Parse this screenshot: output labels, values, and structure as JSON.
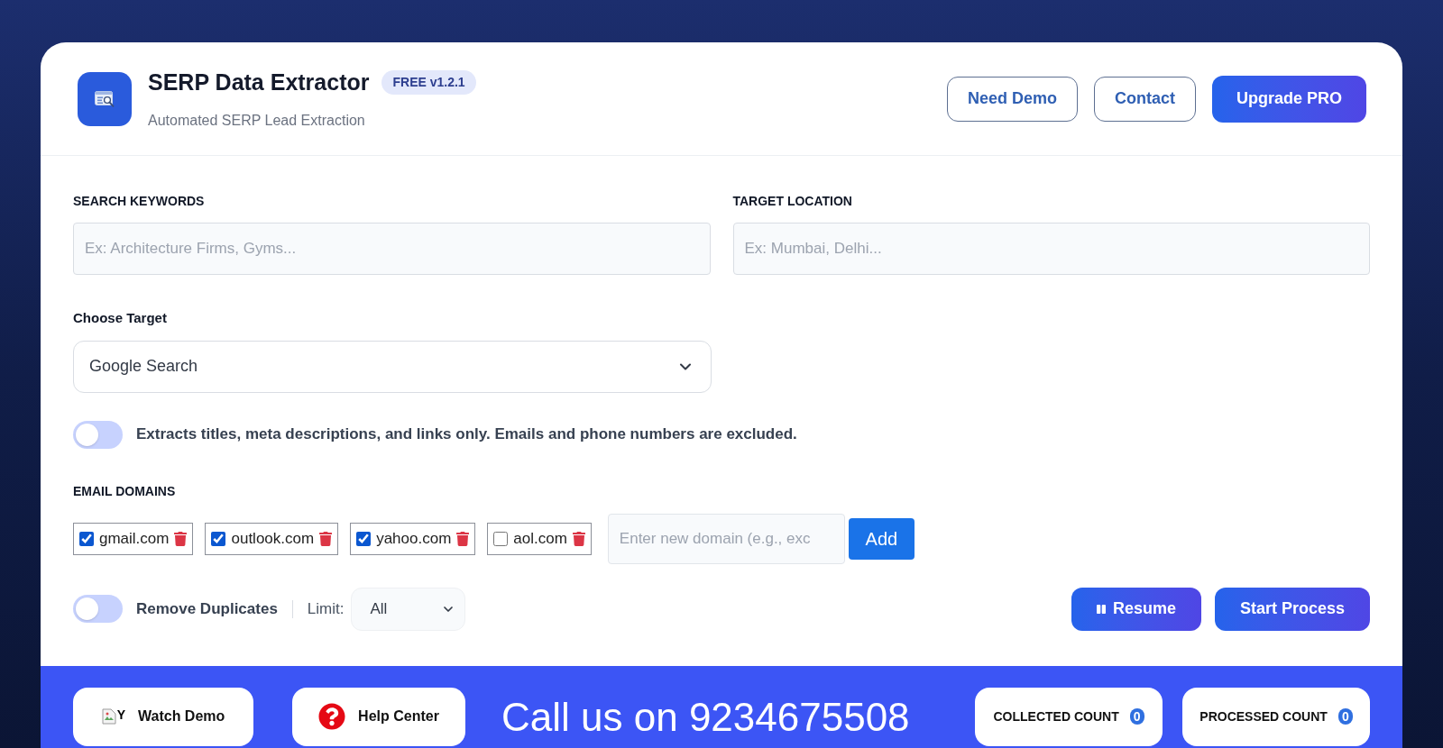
{
  "header": {
    "title": "SERP Data Extractor",
    "badge": "FREE v1.2.1",
    "subtitle": "Automated SERP Lead Extraction",
    "buttons": [
      {
        "label": "Need Demo",
        "kind": "outline"
      },
      {
        "label": "Contact",
        "kind": "outline"
      },
      {
        "label": "Upgrade PRO",
        "kind": "primary"
      }
    ]
  },
  "fields": [
    {
      "label": "SEARCH KEYWORDS",
      "placeholder": "Ex: Architecture Firms, Gyms..."
    },
    {
      "label": "TARGET LOCATION",
      "placeholder": "Ex: Mumbai, Delhi..."
    }
  ],
  "target": {
    "label": "Choose Target",
    "value": "Google Search"
  },
  "mode_toggle": {
    "on": false,
    "text": "Extracts titles, meta descriptions, and links only. Emails and phone numbers are excluded."
  },
  "email_domains": {
    "label": "EMAIL DOMAINS",
    "domains": [
      {
        "name": "gmail.com",
        "checked": true
      },
      {
        "name": "outlook.com",
        "checked": true
      },
      {
        "name": "yahoo.com",
        "checked": true
      },
      {
        "name": "aol.com",
        "checked": false
      }
    ],
    "new_domain": {
      "placeholder": "Enter new domain (e.g., exc"
    },
    "add_button": "Add"
  },
  "options": {
    "remove_duplicates": {
      "label": "Remove Duplicates",
      "on": false
    },
    "limit": {
      "label": "Limit:",
      "value": "All"
    }
  },
  "actions": [
    {
      "label": "Resume",
      "kind": "pause"
    },
    {
      "label": "Start Process",
      "kind": "plain"
    }
  ],
  "footer": {
    "links": [
      {
        "label": "Watch Demo",
        "kind": "image",
        "alt": "Y"
      },
      {
        "label": "Help Center",
        "kind": "help"
      }
    ],
    "call_text": "Call us on 9234675508",
    "counters": [
      {
        "label": "COLLECTED COUNT",
        "value": "0"
      },
      {
        "label": "PROCESSED COUNT",
        "value": "0"
      }
    ]
  }
}
